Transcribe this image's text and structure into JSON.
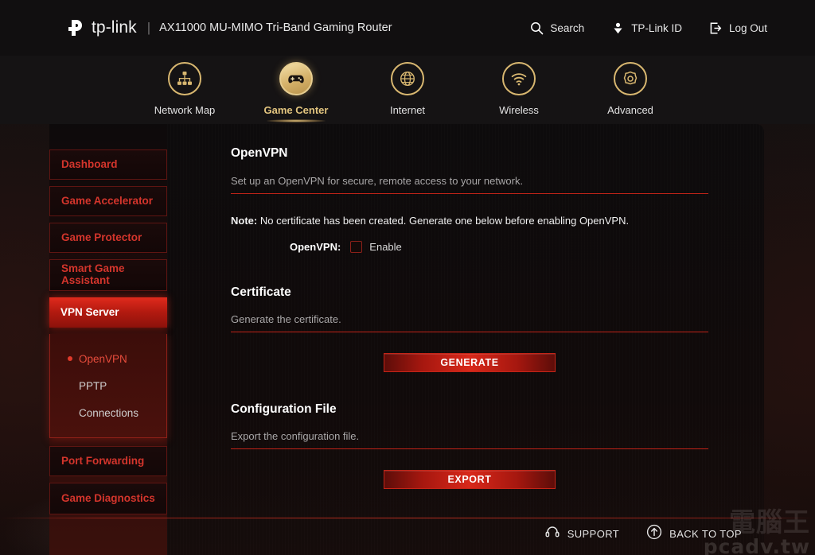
{
  "header": {
    "logo_icon": "tplink-logo-icon",
    "brand": "tp-link",
    "separator": "|",
    "model": "AX11000 MU-MIMO Tri-Band Gaming Router",
    "nav": [
      {
        "label": "Search",
        "icon": "search-icon"
      },
      {
        "label": "TP-Link ID",
        "icon": "tplink-id-icon"
      },
      {
        "label": "Log Out",
        "icon": "logout-icon"
      }
    ]
  },
  "mainnav": {
    "tabs": [
      {
        "label": "Network Map",
        "icon": "network-map-icon",
        "active": false
      },
      {
        "label": "Game Center",
        "icon": "gamepad-icon",
        "active": true
      },
      {
        "label": "Internet",
        "icon": "globe-icon",
        "active": false
      },
      {
        "label": "Wireless",
        "icon": "wifi-icon",
        "active": false
      },
      {
        "label": "Advanced",
        "icon": "gear-icon",
        "active": false
      }
    ]
  },
  "sidebar": {
    "items": [
      {
        "label": "Dashboard",
        "active": false
      },
      {
        "label": "Game Accelerator",
        "active": false
      },
      {
        "label": "Game Protector",
        "active": false
      },
      {
        "label": "Smart Game Assistant",
        "active": false
      },
      {
        "label": "VPN Server",
        "active": true
      },
      {
        "label": "Port Forwarding",
        "active": false
      },
      {
        "label": "Game Diagnostics",
        "active": false
      }
    ],
    "submenu": [
      {
        "label": "OpenVPN",
        "active": true
      },
      {
        "label": "PPTP",
        "active": false
      },
      {
        "label": "Connections",
        "active": false
      }
    ]
  },
  "main": {
    "openvpn": {
      "title": "OpenVPN",
      "description": "Set up an OpenVPN for secure, remote access to your network.",
      "note_label": "Note:",
      "note_text": "No certificate has been created. Generate one below before enabling OpenVPN.",
      "field_label": "OpenVPN:",
      "checkbox_label": "Enable",
      "checkbox_checked": false
    },
    "certificate": {
      "title": "Certificate",
      "description": "Generate the certificate.",
      "button": "GENERATE"
    },
    "configuration": {
      "title": "Configuration File",
      "description": "Export the configuration file.",
      "button": "EXPORT"
    }
  },
  "footer": {
    "items": [
      {
        "label": "SUPPORT",
        "icon": "headset-icon"
      },
      {
        "label": "BACK TO TOP",
        "icon": "arrow-up-circle-icon"
      }
    ]
  },
  "watermark": {
    "cjk": "電腦王",
    "url": "pcadv.tw"
  },
  "colors": {
    "accent_red": "#d8281a",
    "accent_gold": "#d5b169",
    "panel_bg": "#0d0b0c",
    "sidebar_active": "#b31a10"
  }
}
